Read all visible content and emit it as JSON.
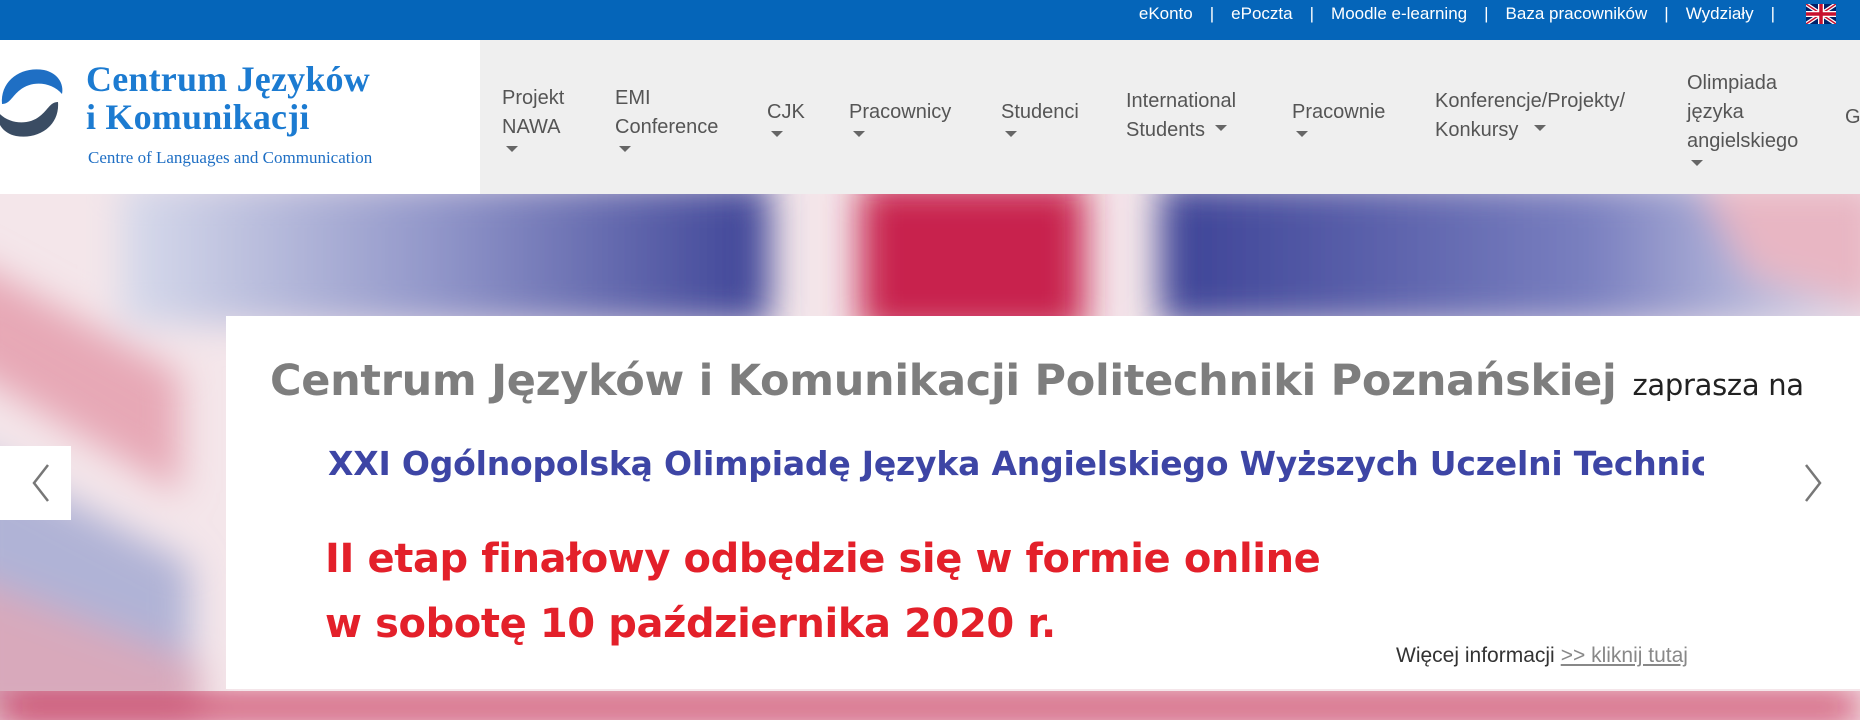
{
  "topbar": {
    "links": [
      "eKonto",
      "ePoczta",
      "Moodle e-learning",
      "Baza pracowników",
      "Wydziały"
    ],
    "separator": "|"
  },
  "logo": {
    "title_line1": "Centrum Języków",
    "title_line2": "i Komunikacji",
    "subtitle": "Centre of Languages and Communication"
  },
  "nav": {
    "items": [
      {
        "label": "Projekt\nNAWA"
      },
      {
        "label": "EMI\nConference"
      },
      {
        "label": "CJK"
      },
      {
        "label": "Pracownicy"
      },
      {
        "label": "Studenci"
      },
      {
        "label": "International\nStudents"
      },
      {
        "label": "Pracownie"
      },
      {
        "label": "Konferencje/Projekty/\nKonkursy"
      },
      {
        "label": "Olimpiada\njęzyka\nangielskiego"
      },
      {
        "label": "G"
      }
    ]
  },
  "hero": {
    "line1": "Centrum Języków i Komunikacji Politechniki Poznańskiej",
    "line1_tail": "zaprasza na",
    "line2": "XXI Ogólnopolską Olimpiadę Języka Angielskiego Wyższych Uczelni Technicznych",
    "line3": "II etap finałowy odbędzie się w formie online",
    "line4": "w sobotę 10 października 2020 r.",
    "more_text": "Więcej informacji",
    "more_link": ">> kliknij tutaj"
  },
  "colors": {
    "topbar": "#0565b9",
    "nav_bg": "#efefef",
    "hero_grey": "#7e7e7e",
    "hero_blue": "#3d45a5",
    "hero_red": "#e3202a"
  },
  "icons": {
    "language_flag": "uk-flag-icon",
    "slider_prev": "chevron-left-icon",
    "slider_next": "chevron-right-icon"
  }
}
